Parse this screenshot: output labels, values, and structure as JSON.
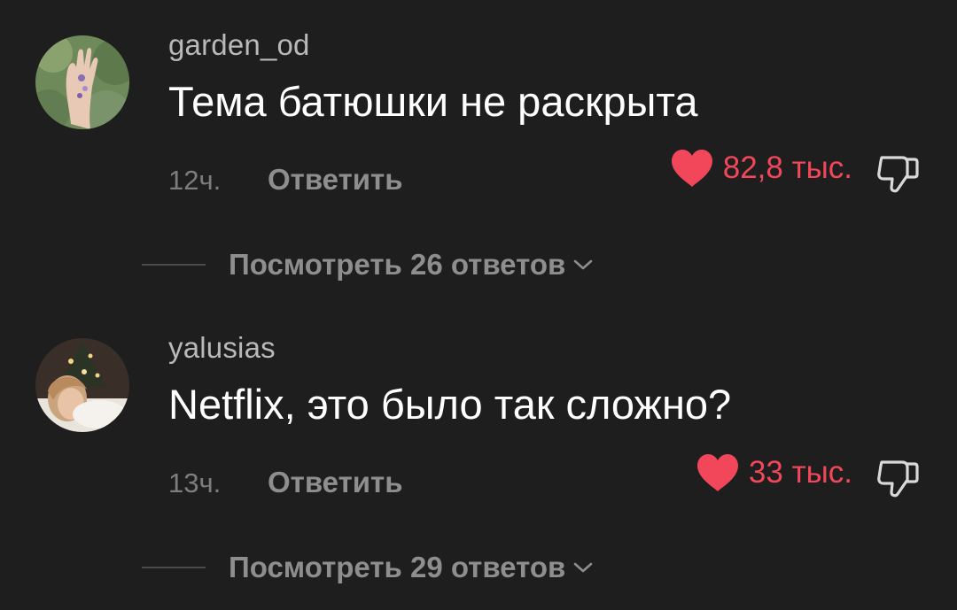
{
  "comments": [
    {
      "username": "garden_od",
      "text": "Тема батюшки не раскрыта",
      "time": "12ч.",
      "reply_label": "Ответить",
      "likes": "82,8 тыс.",
      "view_replies": "Посмотреть 26 ответов"
    },
    {
      "username": "yalusias",
      "text": "Netflix, это было так сложно?",
      "time": "13ч.",
      "reply_label": "Ответить",
      "likes": "33 тыс.",
      "view_replies": "Посмотреть 29 ответов"
    }
  ],
  "colors": {
    "background": "#1e1e1e",
    "like_accent": "#f2465a",
    "secondary_text": "#8e8e8e"
  },
  "icons": [
    "heart-icon",
    "thumbs-down-icon",
    "chevron-down-icon"
  ]
}
